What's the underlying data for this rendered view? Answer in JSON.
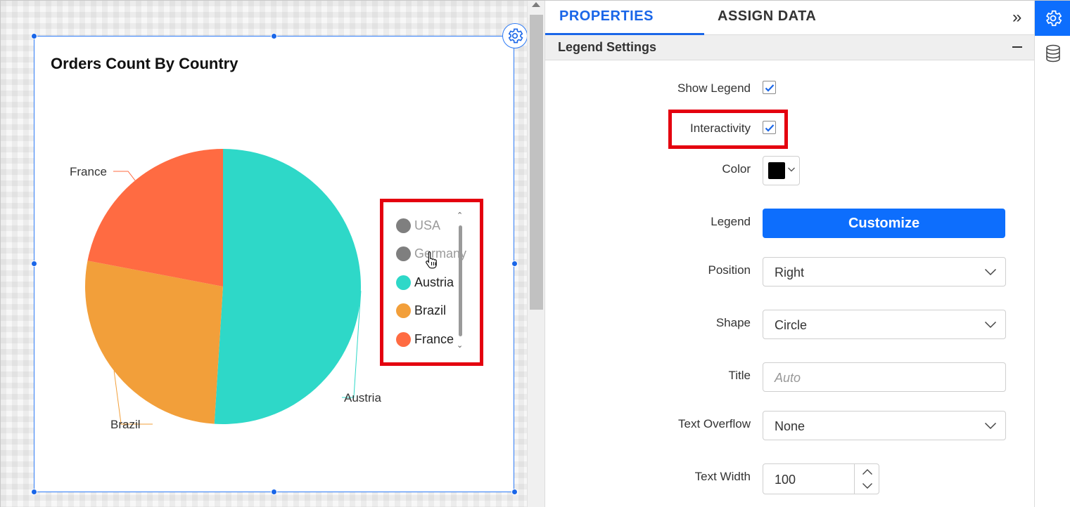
{
  "widget": {
    "title": "Orders Count By Country"
  },
  "chart_data": {
    "type": "pie",
    "title": "Orders Count By Country",
    "series": [
      {
        "label": "Austria",
        "value": 51,
        "color": "#2ed8c8"
      },
      {
        "label": "Brazil",
        "value": 27,
        "color": "#f29f3a"
      },
      {
        "label": "France",
        "value": 22,
        "color": "#ff6b42"
      }
    ],
    "data_labels": [
      "France",
      "Brazil",
      "Austria"
    ]
  },
  "legend": {
    "items": [
      {
        "label": "USA",
        "color": "#7f7f7f",
        "state": "hidden"
      },
      {
        "label": "Germany",
        "color": "#7f7f7f",
        "state": "hidden"
      },
      {
        "label": "Austria",
        "color": "#2ed8c8",
        "state": "visible"
      },
      {
        "label": "Brazil",
        "color": "#f29f3a",
        "state": "visible"
      },
      {
        "label": "France",
        "color": "#ff6b42",
        "state": "visible"
      }
    ]
  },
  "panel": {
    "tabs": [
      {
        "label": "PROPERTIES",
        "active": true
      },
      {
        "label": "ASSIGN DATA",
        "active": false
      }
    ],
    "section_title": "Legend Settings",
    "show_legend": {
      "label": "Show Legend",
      "checked": true
    },
    "interactivity": {
      "label": "Interactivity",
      "checked": true
    },
    "color": {
      "label": "Color",
      "value": "#000000"
    },
    "legend": {
      "label": "Legend",
      "button": "Customize"
    },
    "position": {
      "label": "Position",
      "value": "Right"
    },
    "shape": {
      "label": "Shape",
      "value": "Circle"
    },
    "title": {
      "label": "Title",
      "placeholder": "Auto"
    },
    "text_overflow": {
      "label": "Text Overflow",
      "value": "None"
    },
    "text_width": {
      "label": "Text Width",
      "value": "100"
    }
  },
  "rail": {
    "items": [
      {
        "icon": "gear-icon",
        "active": true
      },
      {
        "icon": "database-icon",
        "active": false
      }
    ]
  },
  "colors": {
    "accent": "#0d6efd",
    "highlight": "#e4000f"
  }
}
